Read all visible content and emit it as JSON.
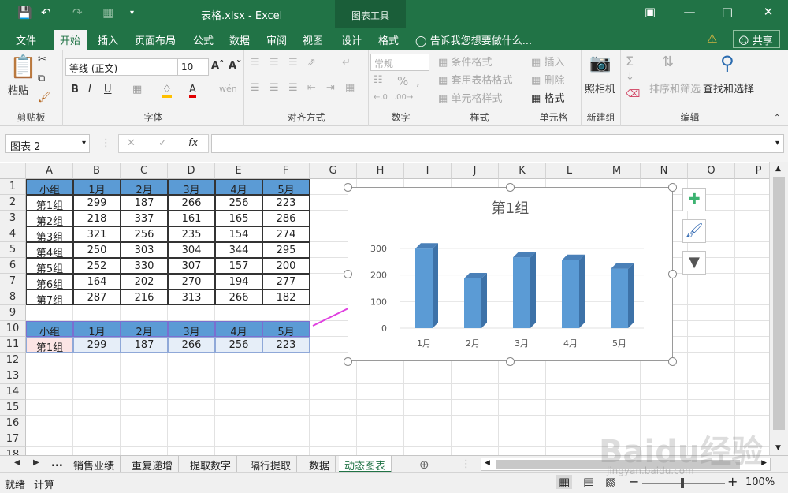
{
  "titlebar": {
    "title": "表格.xlsx - Excel",
    "context_header": "图表工具"
  },
  "tabs": [
    "文件",
    "开始",
    "插入",
    "页面布局",
    "公式",
    "数据",
    "审阅",
    "视图",
    "设计",
    "格式"
  ],
  "active_tab": "开始",
  "tell_me": "告诉我您想要做什么...",
  "share": "共享",
  "ribbon": {
    "paste": "粘贴",
    "clipboard": "剪贴板",
    "font_name": "等线 (正文)",
    "font_size": "10",
    "font_group": "字体",
    "align_group": "对齐方式",
    "number_format": "常规",
    "number_group": "数字",
    "cond_format": "条件格式",
    "table_format": "套用表格格式",
    "cell_style": "单元格样式",
    "style_group": "样式",
    "insert": "插入",
    "delete": "删除",
    "format": "格式",
    "cells_group": "单元格",
    "camera": "照相机",
    "new_group": "新建组",
    "sort_filter": "排序和筛选",
    "find_select": "查找和选择",
    "edit_group": "编辑"
  },
  "formula_bar": {
    "name_box": "图表 2",
    "fx": "fx"
  },
  "columns": [
    "A",
    "B",
    "C",
    "D",
    "E",
    "F",
    "G",
    "H",
    "I",
    "J",
    "K",
    "L",
    "M",
    "N",
    "O",
    "P"
  ],
  "rows": [
    "1",
    "2",
    "3",
    "4",
    "5",
    "6",
    "7",
    "8",
    "9",
    "10",
    "11",
    "12",
    "13",
    "14",
    "15",
    "16",
    "17",
    "18"
  ],
  "table": {
    "header": [
      "小组",
      "1月",
      "2月",
      "3月",
      "4月",
      "5月"
    ],
    "rows": [
      [
        "第1组",
        "299",
        "187",
        "266",
        "256",
        "223"
      ],
      [
        "第2组",
        "218",
        "337",
        "161",
        "165",
        "286"
      ],
      [
        "第3组",
        "321",
        "256",
        "235",
        "154",
        "274"
      ],
      [
        "第4组",
        "250",
        "303",
        "304",
        "344",
        "295"
      ],
      [
        "第5组",
        "252",
        "330",
        "307",
        "157",
        "200"
      ],
      [
        "第6组",
        "164",
        "202",
        "270",
        "194",
        "277"
      ],
      [
        "第7组",
        "287",
        "216",
        "313",
        "266",
        "182"
      ]
    ]
  },
  "dynamic": {
    "header": [
      "小组",
      "1月",
      "2月",
      "3月",
      "4月",
      "5月"
    ],
    "row": [
      "第1组",
      "299",
      "187",
      "266",
      "256",
      "223"
    ]
  },
  "sheets": [
    "...",
    "销售业绩",
    "重复递增",
    "提取数字",
    "隔行提取",
    "数据",
    "动态图表"
  ],
  "active_sheet": "动态图表",
  "status": {
    "ready": "就绪",
    "calc": "计算",
    "zoom": "100%"
  },
  "colors": {
    "excel_green": "#217346",
    "header_blue": "#5b9bd5",
    "bar_blue": "#5b9bd5",
    "arrow": "#e040e0"
  },
  "chart_data": {
    "type": "bar",
    "title": "第1组",
    "categories": [
      "1月",
      "2月",
      "3月",
      "4月",
      "5月"
    ],
    "values": [
      299,
      187,
      266,
      256,
      223
    ],
    "yticks": [
      "0",
      "100",
      "200",
      "300"
    ],
    "ylim": [
      0,
      350
    ]
  },
  "watermark": {
    "text": "Baidu经验",
    "url": "jingyan.baidu.com"
  }
}
